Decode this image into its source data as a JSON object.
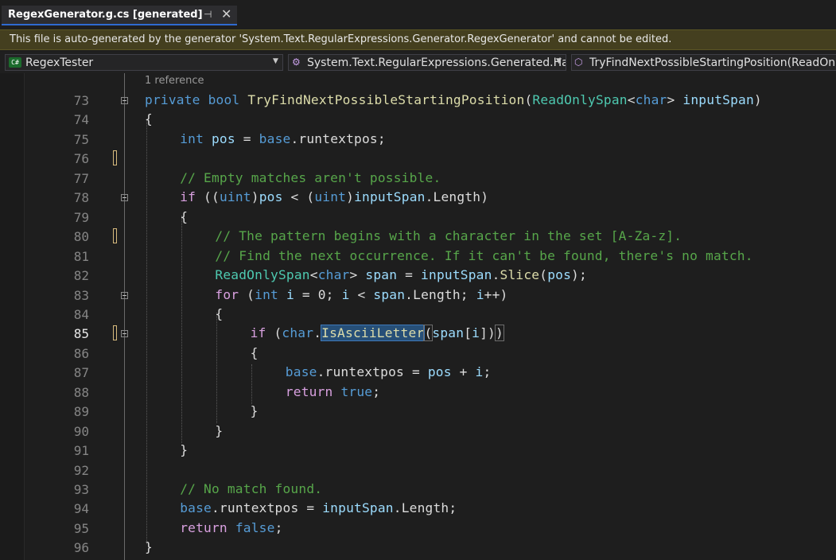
{
  "tab": {
    "title": "RegexGenerator.g.cs [generated]",
    "pin_glyph": "⊣",
    "close_glyph": "✕"
  },
  "infobar": {
    "text": "This file is auto-generated by the generator 'System.Text.RegularExpressions.Generator.RegexGenerator' and cannot be edited."
  },
  "navbar": {
    "project": "RegexTester",
    "project_badge": "C#",
    "type": "System.Text.RegularExpressions.Generated.Has",
    "member": "TryFindNextPossibleStartingPosition(ReadOnly"
  },
  "editor": {
    "codelens": "1 reference",
    "current_line": 85,
    "lines": [
      {
        "n": "73"
      },
      {
        "n": "74"
      },
      {
        "n": "75"
      },
      {
        "n": "76"
      },
      {
        "n": "77"
      },
      {
        "n": "78"
      },
      {
        "n": "79"
      },
      {
        "n": "80"
      },
      {
        "n": "81"
      },
      {
        "n": "82"
      },
      {
        "n": "83"
      },
      {
        "n": "84"
      },
      {
        "n": "85"
      },
      {
        "n": "86"
      },
      {
        "n": "87"
      },
      {
        "n": "88"
      },
      {
        "n": "89"
      },
      {
        "n": "90"
      },
      {
        "n": "91"
      },
      {
        "n": "92"
      },
      {
        "n": "93"
      },
      {
        "n": "94"
      },
      {
        "n": "95"
      },
      {
        "n": "96"
      }
    ],
    "code": {
      "l73": [
        "private",
        " ",
        "bool",
        " ",
        "TryFindNextPossibleStartingPosition",
        "(",
        "ReadOnlySpan",
        "<",
        "char",
        "> ",
        "inputSpan",
        ")"
      ],
      "l74": [
        "{"
      ],
      "l75": [
        "int",
        " ",
        "pos",
        " = ",
        "base",
        ".runtextpos;"
      ],
      "l77": [
        "// Empty matches aren't possible."
      ],
      "l78": [
        "if",
        " ((",
        "uint",
        ")",
        "pos",
        " < (",
        "uint",
        ")",
        "inputSpan",
        ".Length)"
      ],
      "l79": [
        "{"
      ],
      "l80": [
        "// The pattern begins with a character in the set [A-Za-z]."
      ],
      "l81": [
        "// Find the next occurrence. If it can't be found, there's no match."
      ],
      "l82": [
        "ReadOnlySpan",
        "<",
        "char",
        "> ",
        "span",
        " = ",
        "inputSpan",
        ".",
        "Slice",
        "(",
        "pos",
        ");"
      ],
      "l83": [
        "for",
        " (",
        "int",
        " ",
        "i",
        " = 0; ",
        "i",
        " < ",
        "span",
        ".Length; ",
        "i",
        "++)"
      ],
      "l84": [
        "{"
      ],
      "l85": [
        "if",
        " (",
        "char",
        ".",
        "IsAsciiLetter",
        "(",
        "span",
        "[",
        "i",
        "])",
        ")"
      ],
      "l86": [
        "{"
      ],
      "l87": [
        "base",
        ".runtextpos = ",
        "pos",
        " + ",
        "i",
        ";"
      ],
      "l88": [
        "return",
        " ",
        "true",
        ";"
      ],
      "l89": [
        "}"
      ],
      "l90": [
        "}"
      ],
      "l91": [
        "}"
      ],
      "l93": [
        "// No match found."
      ],
      "l94": [
        "base",
        ".runtextpos = ",
        "inputSpan",
        ".Length;"
      ],
      "l95": [
        "return",
        " ",
        "false",
        ";"
      ],
      "l96": [
        "}"
      ]
    }
  },
  "colors": {
    "keyword": "#569cd6",
    "control": "#d8a0df",
    "type": "#4ec9b0",
    "method": "#dcdcaa",
    "identifier": "#9cdcfe",
    "comment": "#57a64a",
    "accent": "#2f6ad0"
  }
}
